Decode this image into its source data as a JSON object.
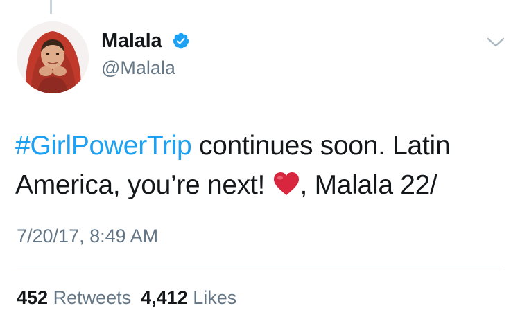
{
  "tweet": {
    "author": {
      "display_name": "Malala",
      "handle": "@Malala",
      "verified": true
    },
    "text": {
      "hashtag": "#GirlPowerTrip",
      "part1": " continues soon. Latin America, you’re next! ",
      "emoji": "heart-emoji",
      "part2": ", Malala 22/"
    },
    "timestamp": "7/20/17, 8:49 AM",
    "stats": {
      "retweets_count": "452",
      "retweets_label": "Retweets",
      "likes_count": "4,412",
      "likes_label": "Likes"
    }
  },
  "colors": {
    "link": "#1da1f2",
    "muted": "#657786",
    "text": "#14171a",
    "divider": "#e1e8ed",
    "verified": "#1da1f2",
    "heart": "#d7263d"
  },
  "icons": [
    "verified-icon",
    "chevron-down-icon",
    "heart-emoji"
  ]
}
